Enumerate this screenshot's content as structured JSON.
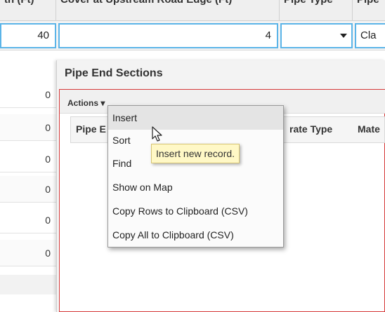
{
  "grid_header": {
    "col_length": "th (Ft)",
    "col_cover": "Cover at Upstream Road Edge (Ft)",
    "col_pipe_type": "Pipe Type",
    "col_next": "Pipe"
  },
  "edit_row": {
    "length_value": "40",
    "cover_value": "4",
    "pipe_type_value": "",
    "next_value": "Cla"
  },
  "left_rows": [
    "0",
    "0",
    "0",
    "0",
    "0",
    "0"
  ],
  "panel": {
    "title": "Pipe End Sections",
    "actions_label": "Actions ▾",
    "columns": [
      "Pipe E",
      "rate Type",
      "Mate"
    ]
  },
  "context_menu": {
    "items": [
      "Insert",
      "Sort",
      "Find",
      "Show on Map",
      "Copy Rows to Clipboard (CSV)",
      "Copy All to Clipboard (CSV)"
    ]
  },
  "tooltip": {
    "text": "Insert new record."
  },
  "colors": {
    "input_border": "#5bb4e8",
    "panel_border": "#d63a3a",
    "tooltip_bg": "#fff8c6"
  }
}
